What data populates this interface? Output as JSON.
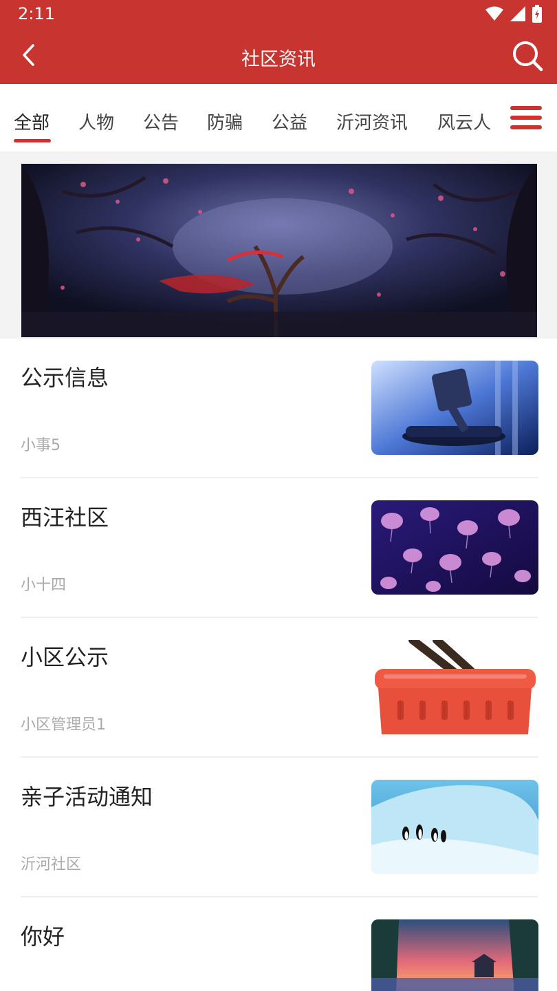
{
  "status_bar": {
    "time": "2:11"
  },
  "app_bar": {
    "title": "社区资讯"
  },
  "tabs": [
    {
      "label": "全部",
      "active": true
    },
    {
      "label": "人物"
    },
    {
      "label": "公告"
    },
    {
      "label": "防骗"
    },
    {
      "label": "公益"
    },
    {
      "label": "沂河资讯"
    },
    {
      "label": "风云人"
    }
  ],
  "colors": {
    "brand": "#c83530",
    "author_text": "#aaaaaa",
    "divider": "#eeeeee"
  },
  "icons": {
    "back": "back-arrow-icon",
    "search": "search-icon",
    "menu": "menu-icon",
    "wifi": "wifi-icon",
    "signal": "signal-icon",
    "battery": "battery-icon"
  },
  "banner": {
    "image": "fantasy forest with red ribbons"
  },
  "news_items": [
    {
      "title": "公示信息",
      "author": "小事5",
      "thumb": "gavel"
    },
    {
      "title": "西汪社区",
      "author": "小十四",
      "thumb": "jellyfish"
    },
    {
      "title": "小区公示",
      "author": "小区管理员1",
      "thumb": "shopping-basket"
    },
    {
      "title": "亲子活动通知",
      "author": "沂河社区",
      "thumb": "penguins-on-ice"
    },
    {
      "title": "你好",
      "author": "",
      "thumb": "sunset-lake"
    }
  ]
}
